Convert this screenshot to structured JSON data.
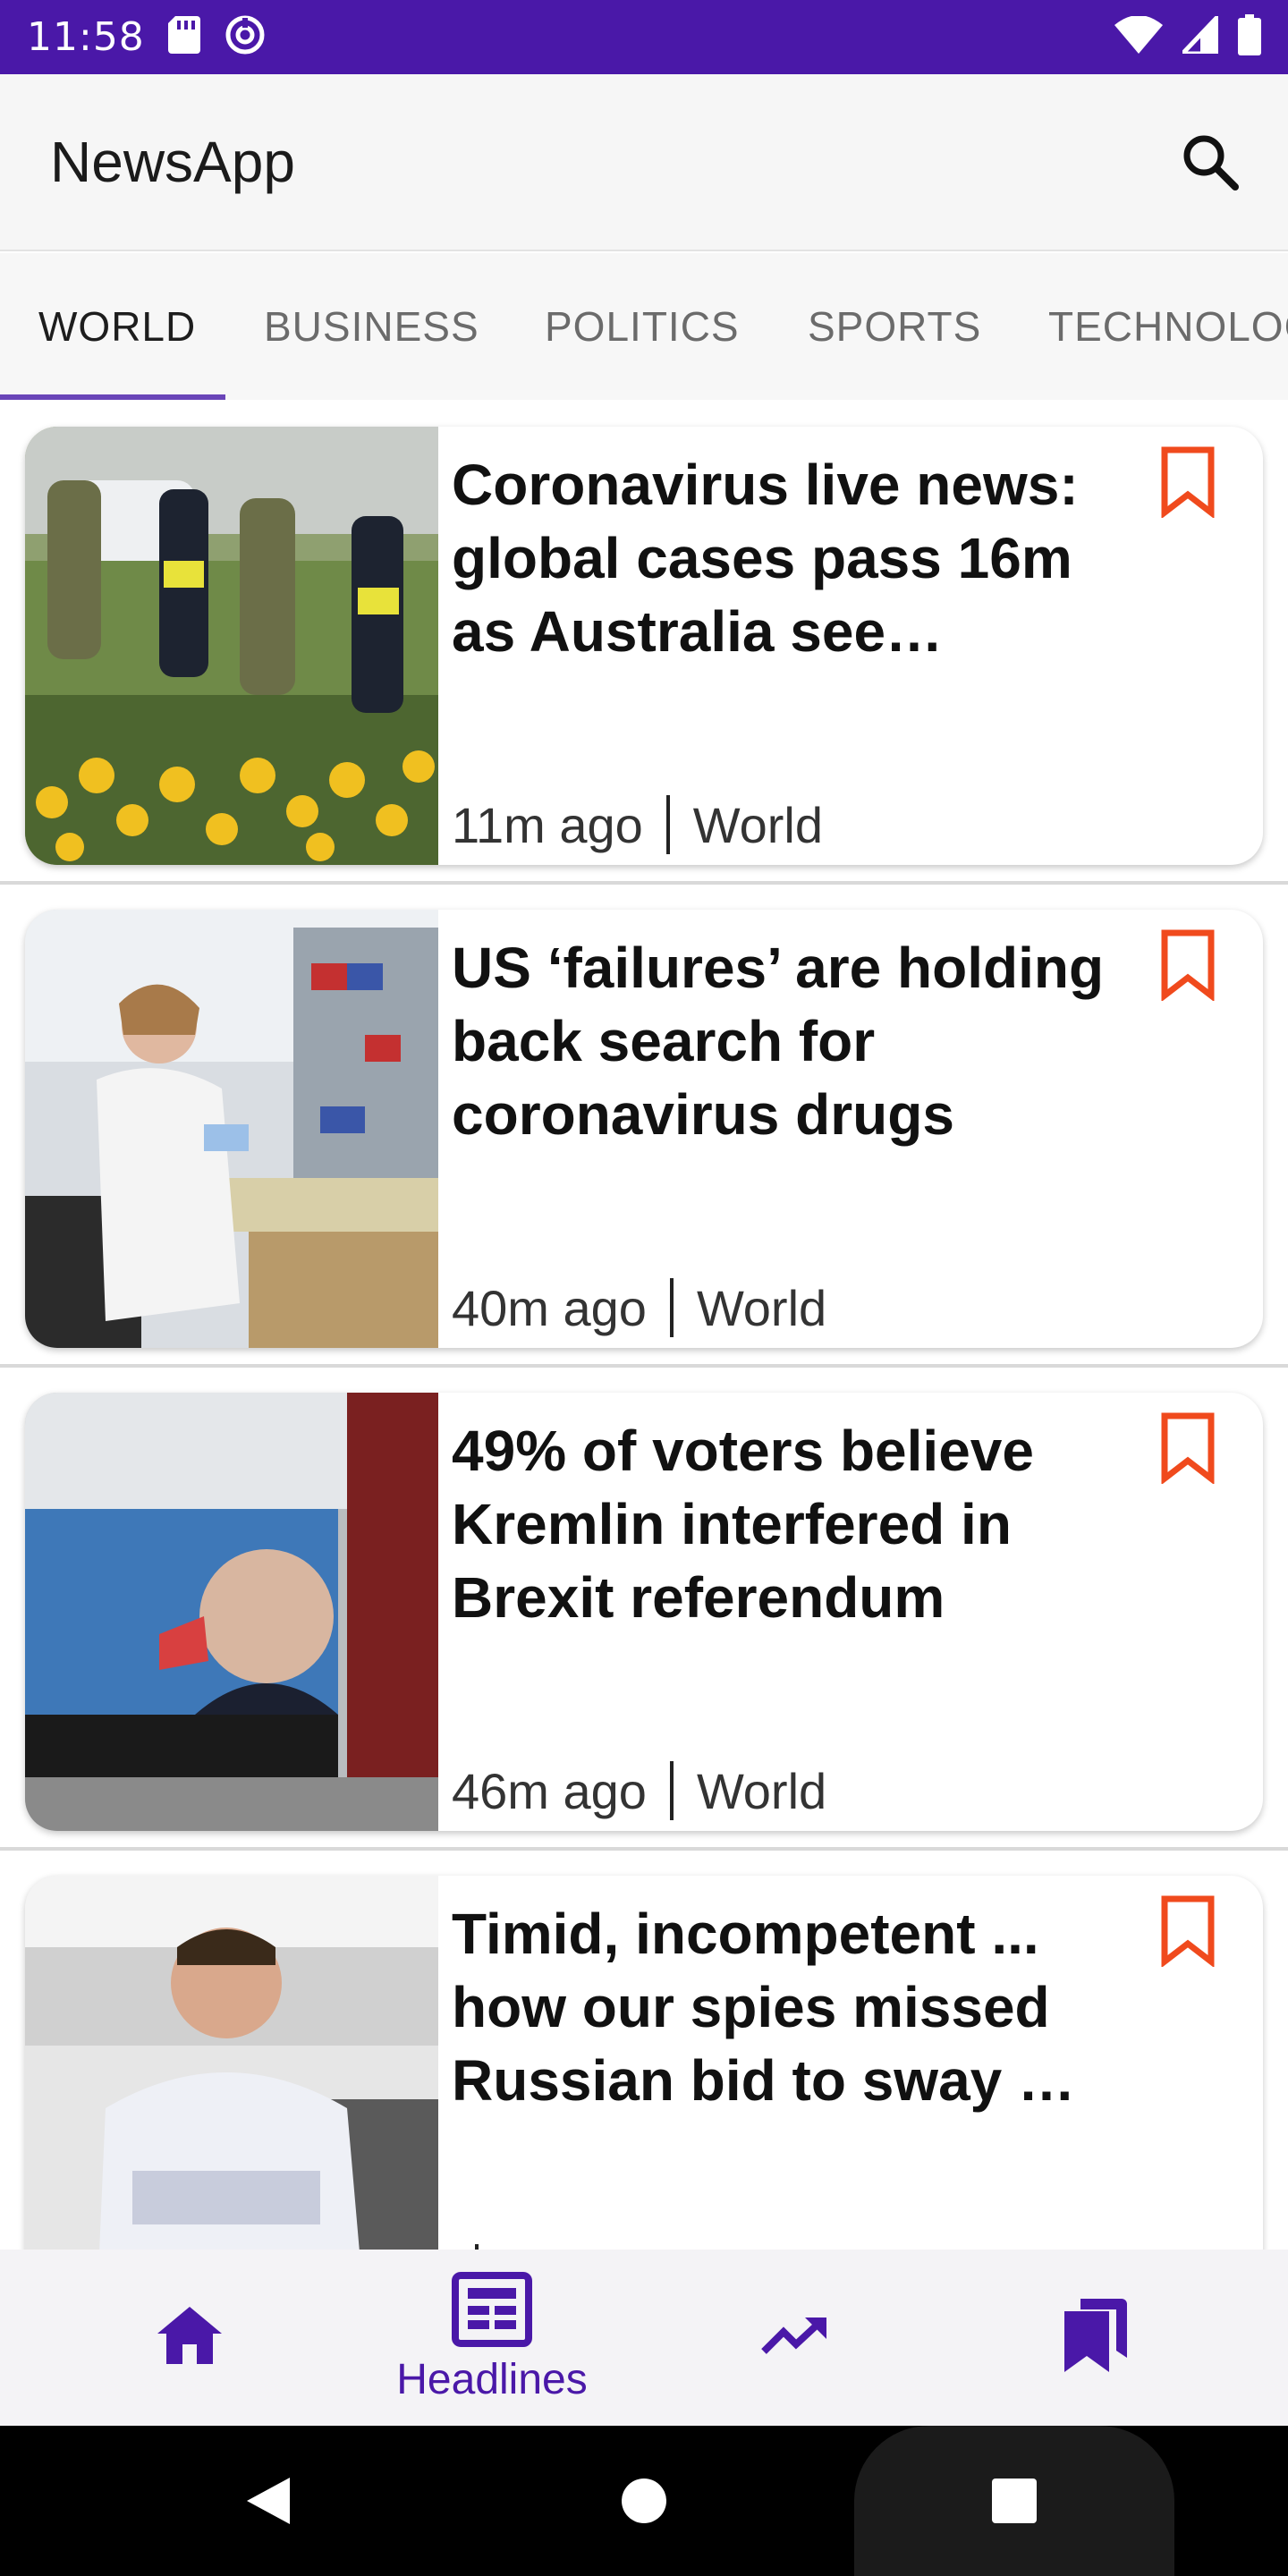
{
  "status_bar": {
    "time": "11:58",
    "icons": [
      "sd-card-icon",
      "data-saver-icon",
      "wifi-icon",
      "signal-icon",
      "battery-icon"
    ]
  },
  "app_bar": {
    "title": "NewsApp",
    "search_icon": "search-icon"
  },
  "tabs": [
    {
      "label": "WORLD",
      "active": true
    },
    {
      "label": "BUSINESS",
      "active": false
    },
    {
      "label": "POLITICS",
      "active": false
    },
    {
      "label": "SPORTS",
      "active": false
    },
    {
      "label": "TECHNOLOG",
      "active": false
    }
  ],
  "articles": [
    {
      "headline": "Coronavirus live news: global cases pass 16m as Australia see…",
      "time": "11m ago",
      "section": "World",
      "bookmark_icon": "bookmark-outline-icon"
    },
    {
      "headline": "US ‘failures’ are holding back search for coronavirus drugs",
      "time": "40m ago",
      "section": "World",
      "bookmark_icon": "bookmark-outline-icon"
    },
    {
      "headline": "49% of voters believe Kremlin interfered in Brexit referendum",
      "time": "46m ago",
      "section": "World",
      "bookmark_icon": "bookmark-outline-icon"
    },
    {
      "headline": "Timid, incompetent ... how our spies missed Russian bid to sway …",
      "time": "",
      "section": "",
      "bookmark_icon": "bookmark-outline-icon"
    }
  ],
  "bottom_nav": [
    {
      "icon": "home-icon",
      "label": "",
      "selected": false
    },
    {
      "icon": "newspaper-icon",
      "label": "Headlines",
      "selected": true
    },
    {
      "icon": "trending-icon",
      "label": "",
      "selected": false
    },
    {
      "icon": "bookmarks-icon",
      "label": "",
      "selected": false
    }
  ],
  "system_nav": [
    "back-icon",
    "home-circle-icon",
    "recents-icon"
  ],
  "colors": {
    "status_bar": "#4a18a8",
    "accent": "#4a18a8",
    "tab_indicator": "#6a45b8",
    "bookmark": "#f04a1d"
  }
}
